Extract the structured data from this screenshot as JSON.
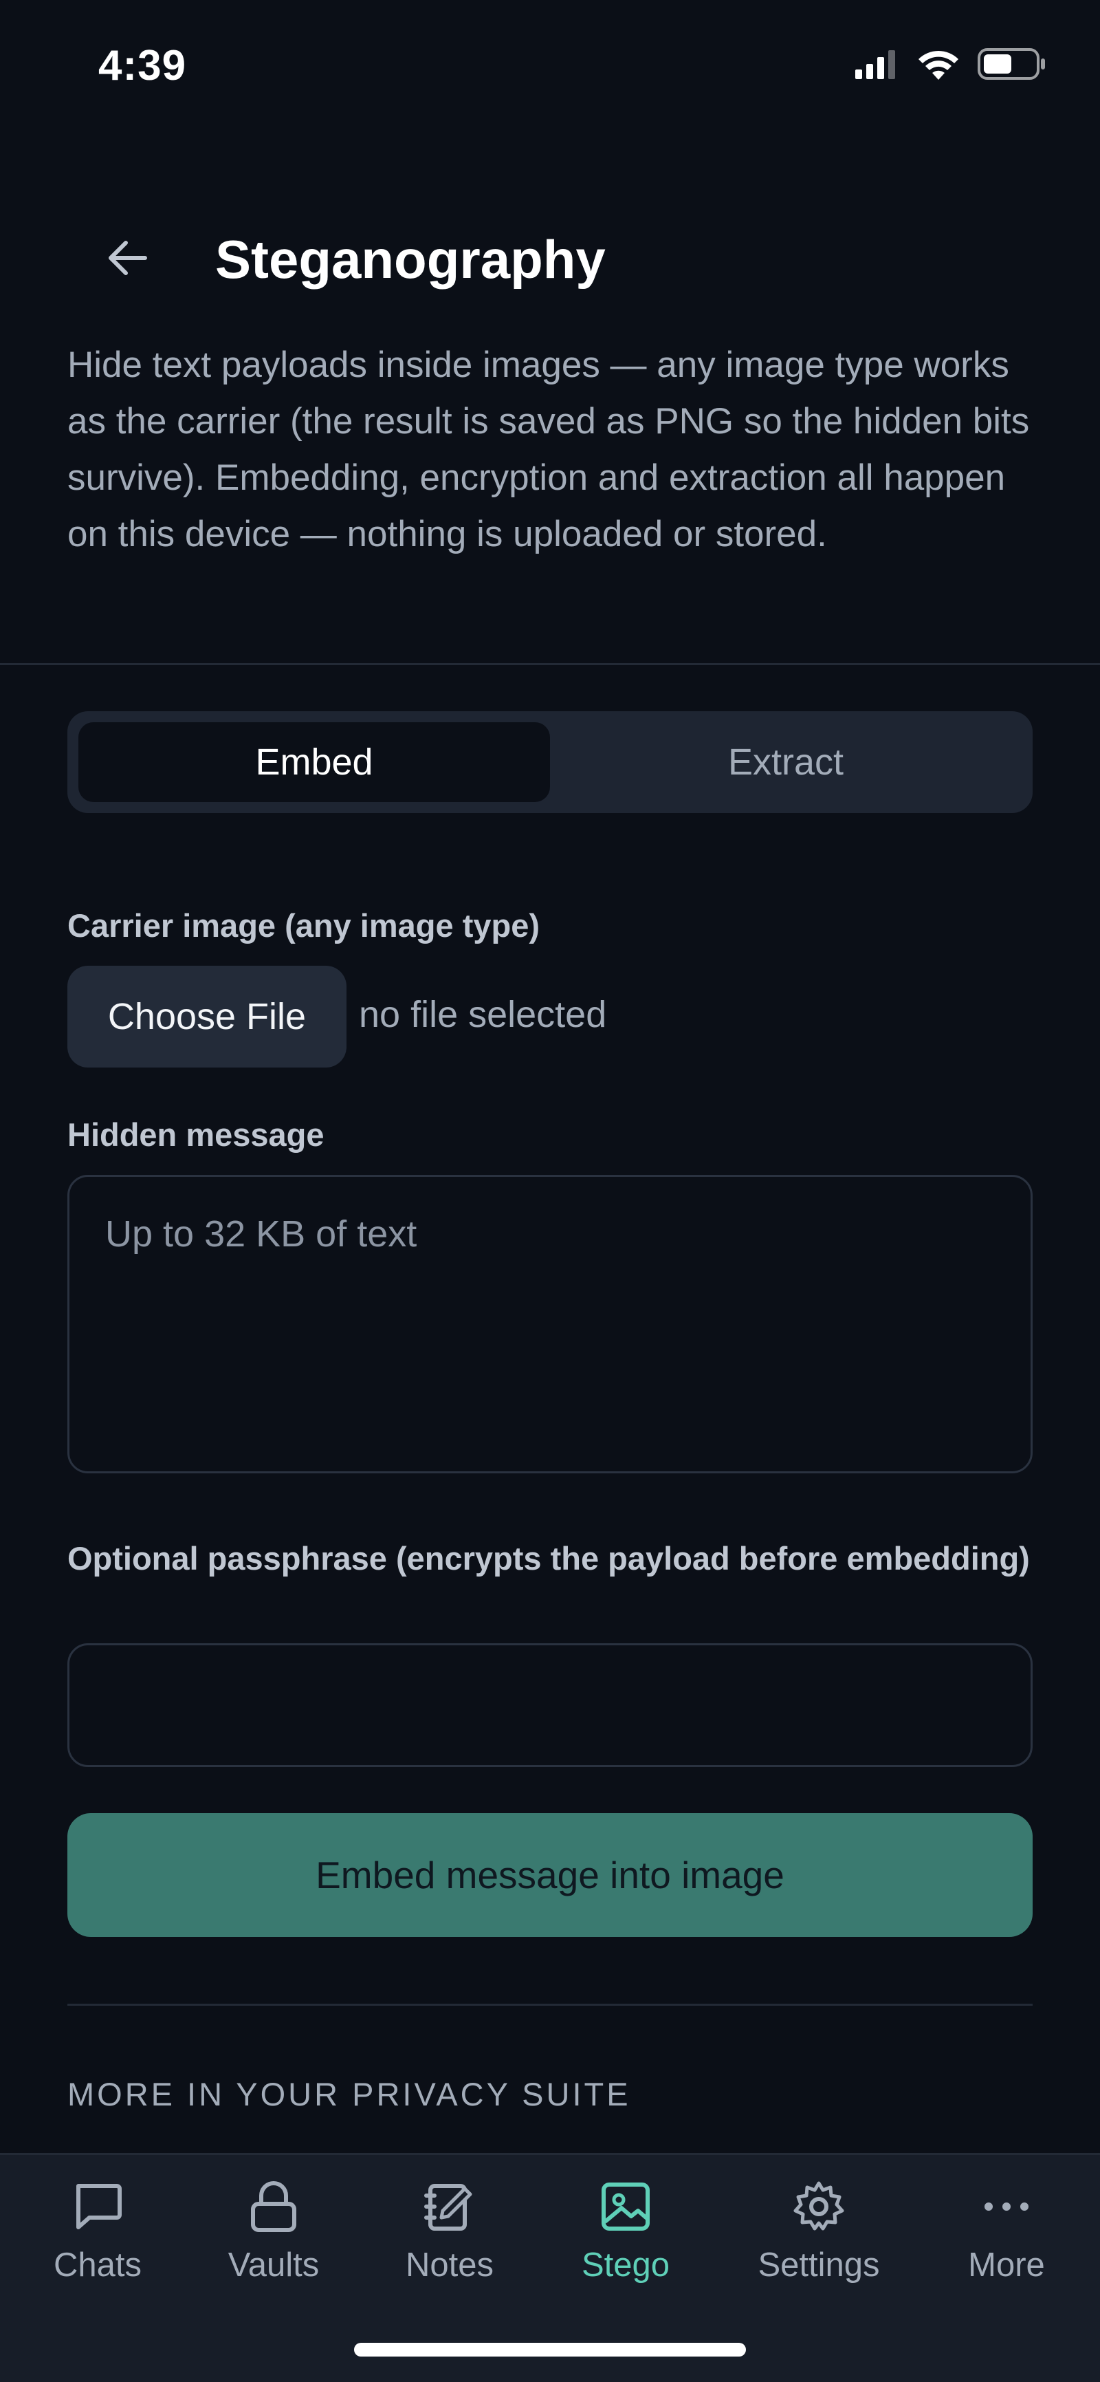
{
  "status_bar": {
    "time": "4:39",
    "icons": [
      "cellular-signal-icon",
      "wifi-icon",
      "battery-icon"
    ]
  },
  "header": {
    "back_icon": "arrow-left-icon",
    "title": "Steganography",
    "description": "Hide text payloads inside images — any image type works as the carrier (the result is saved as PNG so the hidden bits survive). Embedding, encryption and extraction all happen on this device — nothing is uploaded or stored."
  },
  "mode_switch": {
    "options": [
      {
        "label": "Embed",
        "selected": true
      },
      {
        "label": "Extract",
        "selected": false
      }
    ]
  },
  "form": {
    "carrier_label": "Carrier image (any image type)",
    "choose_file_label": "Choose File",
    "file_status": "no file selected",
    "message_label": "Hidden message",
    "message_value": "",
    "message_placeholder": "Up to 32 KB of text",
    "passphrase_label": "Optional passphrase (encrypts the payload before embedding)",
    "passphrase_value": "",
    "submit_label": "Embed message into image"
  },
  "suite": {
    "heading": "MORE IN YOUR PRIVACY SUITE"
  },
  "tab_bar": {
    "items": [
      {
        "label": "Chats",
        "icon": "chat-bubble-icon",
        "active": false
      },
      {
        "label": "Vaults",
        "icon": "lock-icon",
        "active": false
      },
      {
        "label": "Notes",
        "icon": "notebook-icon",
        "active": false
      },
      {
        "label": "Stego",
        "icon": "image-icon",
        "active": true
      },
      {
        "label": "Settings",
        "icon": "gear-icon",
        "active": false
      },
      {
        "label": "More",
        "icon": "ellipsis-icon",
        "active": false
      }
    ]
  },
  "colors": {
    "background": "#0b0f17",
    "accent": "#5fd0b8",
    "primary_button": "#3a7a70",
    "tab_bar": "#171d28"
  }
}
